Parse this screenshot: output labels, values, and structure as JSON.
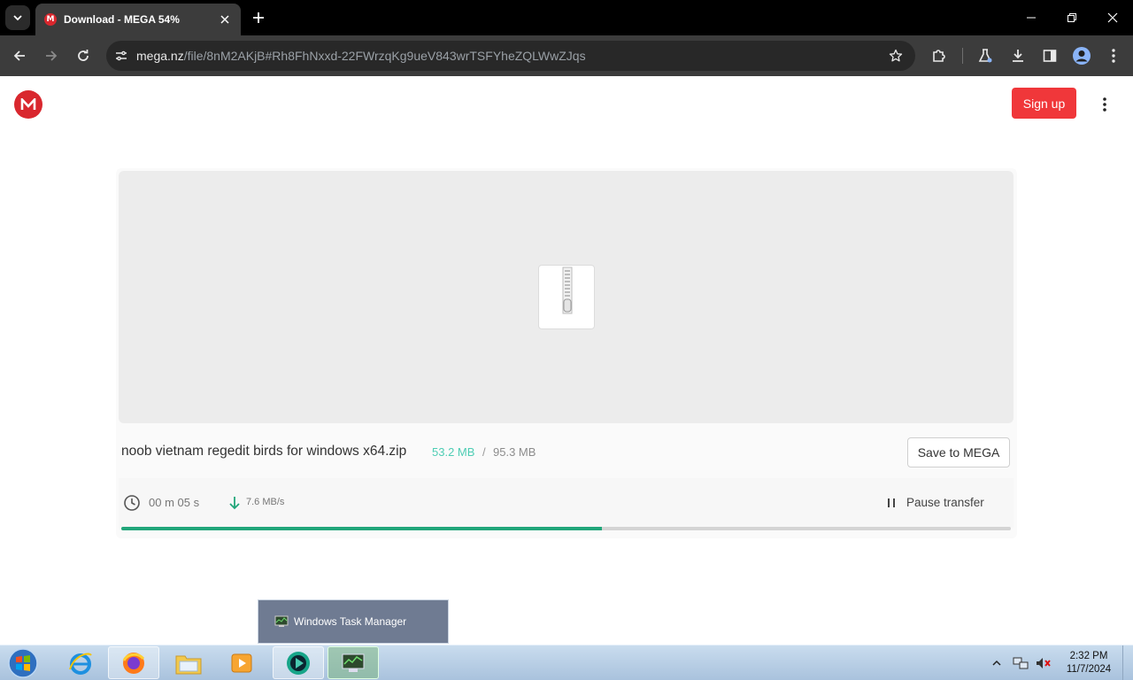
{
  "browser": {
    "tab_title": "Download - MEGA 54%",
    "favicon_letter": "M",
    "url_domain": "mega.nz",
    "url_path": "/file/8nM2AKjB#Rh8FhNxxd-22FWrzqKg9ueV843wrTSFYheZQLWwZJqs"
  },
  "page": {
    "signup_label": "Sign up",
    "file_name": "noob vietnam regedit birds for windows x64.zip",
    "size_downloaded": "53.2 MB",
    "size_separator": "/",
    "size_total": "95.3 MB",
    "save_label": "Save to MEGA",
    "time_remaining": "00 m  05 s",
    "speed": "7.6 MB/s",
    "pause_label": "Pause transfer",
    "progress_fraction": 0.54,
    "colors": {
      "brand_red": "#d9272e",
      "signup_red": "#f0373a",
      "progress_green": "#21a67a",
      "downloaded_teal": "#4ecdb4"
    }
  },
  "taskbar": {
    "popup_label": "Windows Task Manager",
    "time": "2:32 PM",
    "date": "11/7/2024",
    "items": [
      "internet-explorer",
      "firefox",
      "file-explorer",
      "media-player",
      "chrome",
      "task-manager"
    ]
  }
}
